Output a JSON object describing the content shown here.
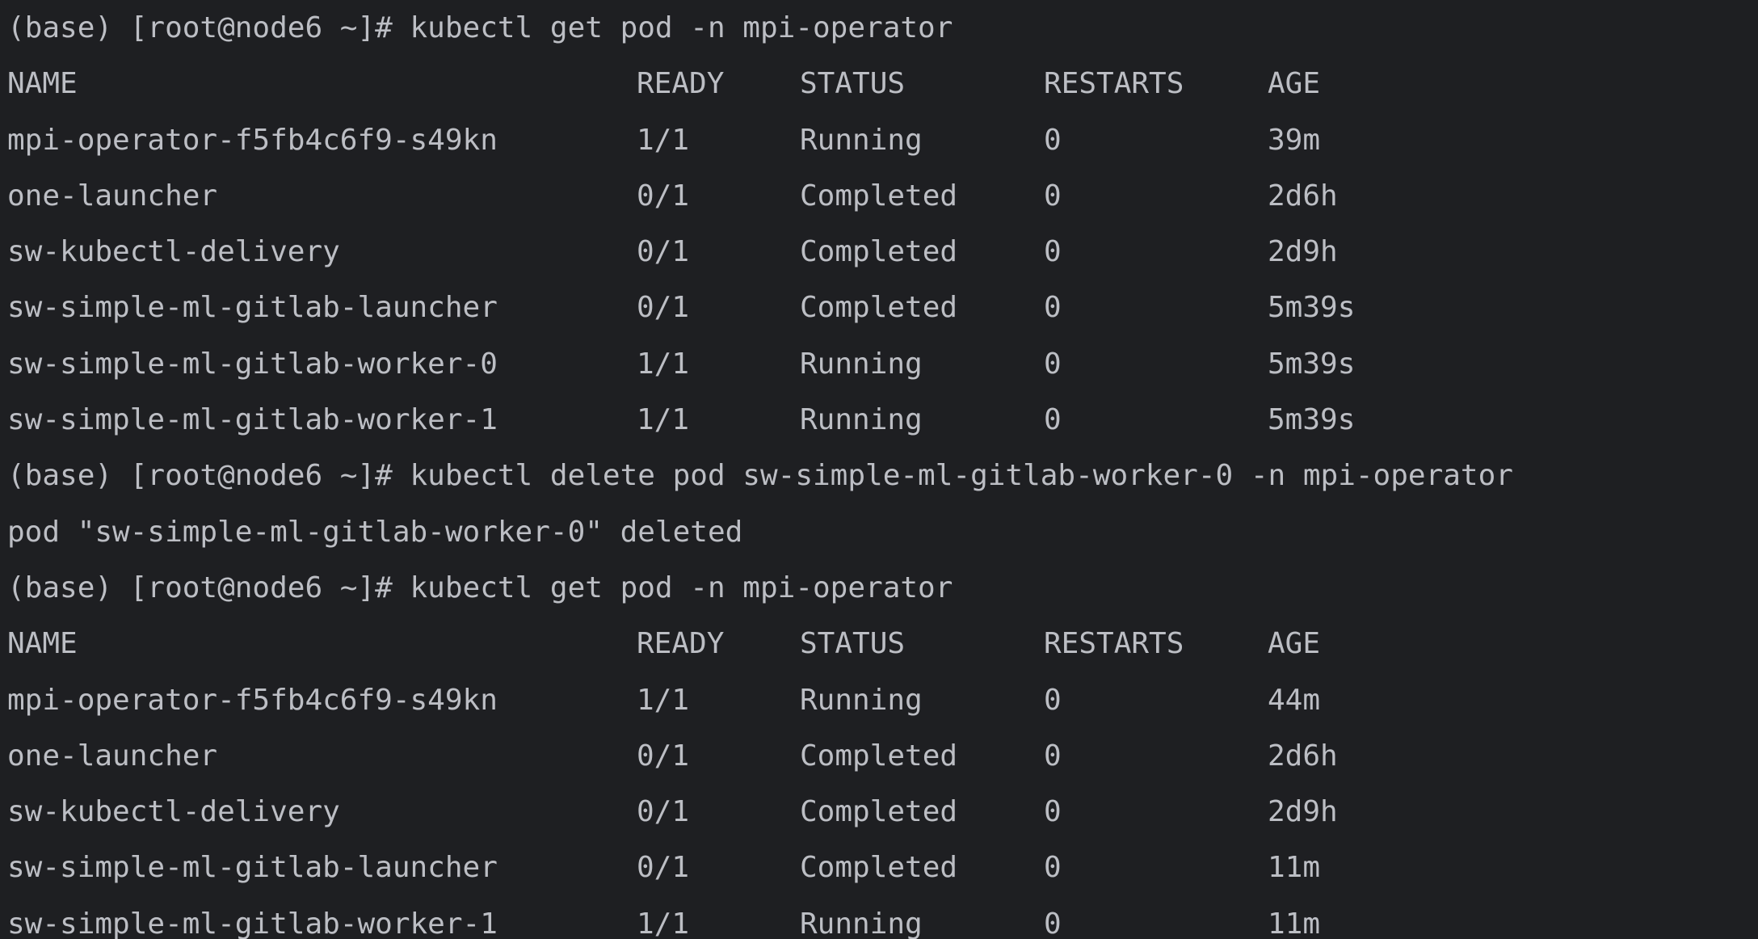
{
  "terminal": {
    "prompt": "(base) [root@node6 ~]# ",
    "blocks": [
      {
        "command": "kubectl get pod -n mpi-operator",
        "headers": [
          "NAME",
          "READY",
          "STATUS",
          "RESTARTS",
          "AGE"
        ],
        "rows": [
          [
            "mpi-operator-f5fb4c6f9-s49kn",
            "1/1",
            "Running",
            "0",
            "39m"
          ],
          [
            "one-launcher",
            "0/1",
            "Completed",
            "0",
            "2d6h"
          ],
          [
            "sw-kubectl-delivery",
            "0/1",
            "Completed",
            "0",
            "2d9h"
          ],
          [
            "sw-simple-ml-gitlab-launcher",
            "0/1",
            "Completed",
            "0",
            "5m39s"
          ],
          [
            "sw-simple-ml-gitlab-worker-0",
            "1/1",
            "Running",
            "0",
            "5m39s"
          ],
          [
            "sw-simple-ml-gitlab-worker-1",
            "1/1",
            "Running",
            "0",
            "5m39s"
          ]
        ]
      },
      {
        "command": "kubectl delete pod sw-simple-ml-gitlab-worker-0 -n mpi-operator",
        "output": "pod \"sw-simple-ml-gitlab-worker-0\" deleted"
      },
      {
        "command": "kubectl get pod -n mpi-operator",
        "headers": [
          "NAME",
          "READY",
          "STATUS",
          "RESTARTS",
          "AGE"
        ],
        "rows": [
          [
            "mpi-operator-f5fb4c6f9-s49kn",
            "1/1",
            "Running",
            "0",
            "44m"
          ],
          [
            "one-launcher",
            "0/1",
            "Completed",
            "0",
            "2d6h"
          ],
          [
            "sw-kubectl-delivery",
            "0/1",
            "Completed",
            "0",
            "2d9h"
          ],
          [
            "sw-simple-ml-gitlab-launcher",
            "0/1",
            "Completed",
            "0",
            "11m"
          ],
          [
            "sw-simple-ml-gitlab-worker-1",
            "1/1",
            "Running",
            "0",
            "11m"
          ]
        ]
      }
    ]
  },
  "colors": {
    "background": "#1e1f22",
    "text": "#bcbec4"
  }
}
